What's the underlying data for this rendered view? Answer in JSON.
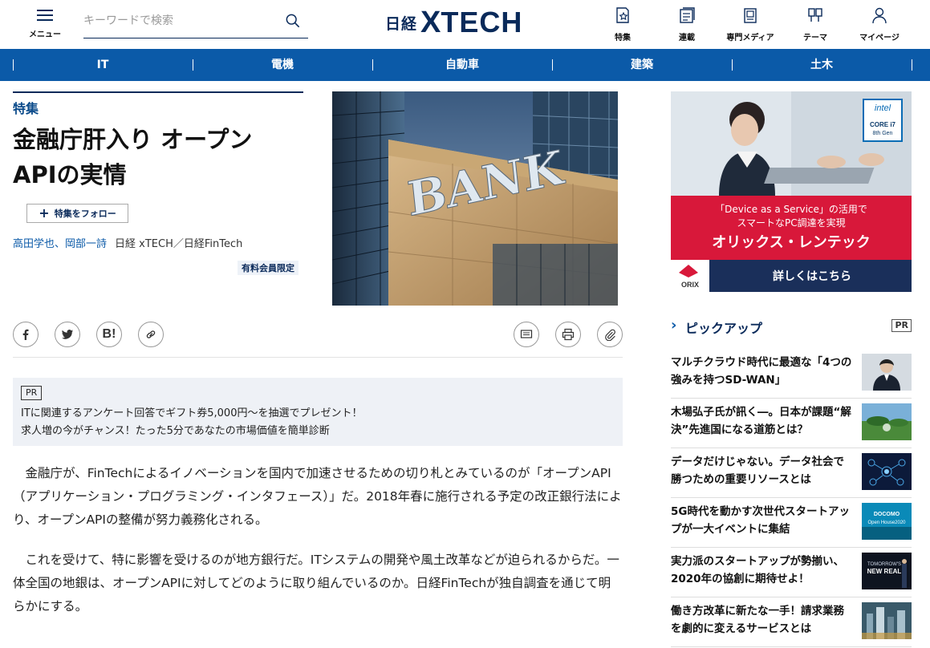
{
  "header": {
    "menu_label": "メニュー",
    "search_placeholder": "キーワードで検索",
    "logo_nikkei": "日経",
    "logo_x": "X",
    "logo_tech": "TECH",
    "nav": [
      {
        "label": "特集",
        "icon": "feature-icon"
      },
      {
        "label": "連載",
        "icon": "series-icon"
      },
      {
        "label": "専門メディア",
        "icon": "media-icon"
      },
      {
        "label": "テーマ",
        "icon": "theme-icon"
      },
      {
        "label": "マイページ",
        "icon": "user-icon"
      }
    ]
  },
  "categories": [
    "IT",
    "電機",
    "自動車",
    "建築",
    "土木"
  ],
  "article": {
    "section_label": "特集",
    "title_line1": "金融庁肝入り オープン",
    "title_line2": "APIの実情",
    "follow_label": "特集をフォロー",
    "authors": "高田学也、岡部一詩",
    "publication": "日経 xTECH／日経FinTech",
    "paid_label": "有料会員限定",
    "hero_text": "BANK",
    "share_icons": [
      "facebook-icon",
      "twitter-icon",
      "hatena-bookmark-icon",
      "link-icon"
    ],
    "tool_icons": [
      "comment-icon",
      "print-icon",
      "clip-icon"
    ],
    "hatena_label": "B!",
    "pr": {
      "tag": "PR",
      "links": [
        "ITに関連するアンケート回答でギフト券5,000円〜を抽選でプレゼント！",
        "求人増の今がチャンス！たった5分であなたの市場価値を簡単診断"
      ]
    },
    "paragraphs": [
      "　金融庁が、FinTechによるイノベーションを国内で加速させるための切り札とみているのが「オープンAPI（アプリケーション・プログラミング・インタフェース）」だ。2018年春に施行される予定の改正銀行法により、オープンAPIの整備が努力義務化される。",
      "　これを受けて、特に影響を受けるのが地方銀行だ。ITシステムの開発や風土改革などが迫られるからだ。一体全国の地銀は、オープンAPIに対してどのように取り組んでいるのか。日経FinTechが独自調査を通じて明らかにする。"
    ]
  },
  "ad": {
    "cpu_brand": "intel",
    "cpu_model": "CORE i7",
    "cpu_gen": "8th Gen",
    "line1": "「Device as a Service」の活用で",
    "line2": "スマートなPC調達を実現",
    "brand": "オリックス・レンテック",
    "logo": "ORIX",
    "cta": "詳しくはこちら"
  },
  "pickup": {
    "title": "ピックアップ",
    "pr_tag": "PR",
    "items": [
      {
        "text": "マルチクラウド時代に最適な「4つの強みを持つSD-WAN」",
        "thumb": "portrait"
      },
      {
        "text": "木場弘子氏が訊く―。日本が課題“解決”先進国になる道筋とは？",
        "thumb": "landscape"
      },
      {
        "text": "データだけじゃない。データ社会で勝つための重要リソースとは",
        "thumb": "network"
      },
      {
        "text": "5G時代を動かす次世代スタートアップが一大イベントに集結",
        "thumb": "docomo",
        "thumb_text1": "DOCOMO",
        "thumb_text2": "Open House2020"
      },
      {
        "text": "実力派のスタートアップが勢揃い、2020年の協創に期待せよ！",
        "thumb": "newreal",
        "thumb_text1": "TOMORROW'S",
        "thumb_text2": "NEW REAL"
      },
      {
        "text": "働き方改革に新たな一手！請求業務を劇的に変えるサービスとは",
        "thumb": "city"
      }
    ]
  }
}
